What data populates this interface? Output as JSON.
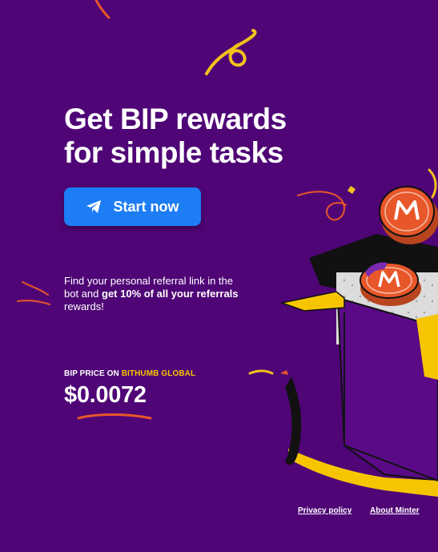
{
  "hero": {
    "title_line1": "Get BIP rewards",
    "title_line2": "for simple tasks",
    "start_label": "Start now"
  },
  "referral": {
    "text_1": "Find your personal referral link in the bot and ",
    "text_bold": "get 10% of all your referrals",
    "text_2": " rewards!"
  },
  "price": {
    "label_prefix": "BIP PRICE ON ",
    "exchange": "BITHUMB GLOBAL",
    "value": "$0.0072"
  },
  "footer": {
    "privacy": "Privacy policy",
    "about": "About Minter"
  },
  "icons": {
    "start_button_icon": "telegram-plane-icon",
    "coin_icon": "minter-logo-coin"
  },
  "colors": {
    "background": "#4f0576",
    "button": "#1d7df5",
    "accent_yellow": "#f7c500",
    "accent_orange": "#e8572a"
  }
}
